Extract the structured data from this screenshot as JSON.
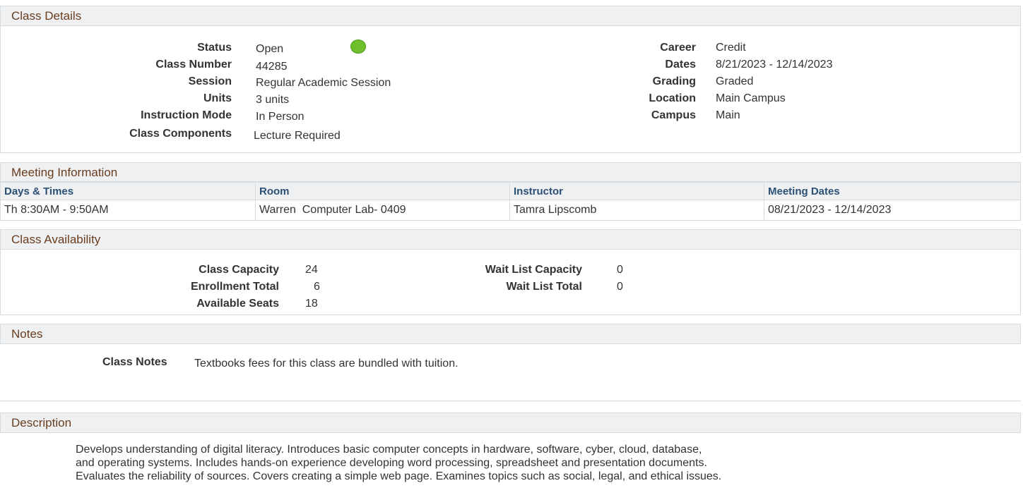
{
  "class_details": {
    "header": "Class Details",
    "left": [
      {
        "label": "Status",
        "value": "Open"
      },
      {
        "label": "Class Number",
        "value": "44285"
      },
      {
        "label": "Session",
        "value": "Regular Academic Session"
      },
      {
        "label": "Units",
        "value": "3 units"
      },
      {
        "label": "Instruction Mode",
        "value": "In Person"
      },
      {
        "label": "Class Components",
        "value": "Lecture Required"
      }
    ],
    "right": [
      {
        "label": "Career",
        "value": "Credit"
      },
      {
        "label": "Dates",
        "value": "8/21/2023 - 12/14/2023"
      },
      {
        "label": "Grading",
        "value": "Graded"
      },
      {
        "label": "Location",
        "value": "Main Campus"
      },
      {
        "label": "Campus",
        "value": "Main"
      }
    ],
    "status_icon": "green-circle-open-icon",
    "status_color": "#6fbf2c"
  },
  "meeting": {
    "header": "Meeting Information",
    "columns": [
      "Days & Times",
      "Room",
      "Instructor",
      "Meeting Dates"
    ],
    "rows": [
      [
        "Th 8:30AM - 9:50AM",
        "Warren  Computer Lab- 0409",
        "Tamra Lipscomb",
        "08/21/2023 - 12/14/2023"
      ]
    ]
  },
  "availability": {
    "header": "Class Availability",
    "left": [
      {
        "label": "Class Capacity",
        "value": "24"
      },
      {
        "label": "Enrollment Total",
        "value": "6"
      },
      {
        "label": "Available Seats",
        "value": "18"
      }
    ],
    "right": [
      {
        "label": "Wait List Capacity",
        "value": "0"
      },
      {
        "label": "Wait List Total",
        "value": "0"
      }
    ]
  },
  "notes": {
    "header": "Notes",
    "label": "Class Notes",
    "value": "Textbooks fees for this class are bundled with tuition."
  },
  "description": {
    "header": "Description",
    "lines": [
      "Develops understanding of digital literacy. Introduces basic computer concepts in hardware, software, cyber, cloud, database,",
      "and operating systems. Includes hands-on experience developing word processing, spreadsheet and presentation documents.",
      "Evaluates the reliability of sources. Covers creating a simple web page. Examines topics such as social, legal, and ethical issues."
    ]
  }
}
